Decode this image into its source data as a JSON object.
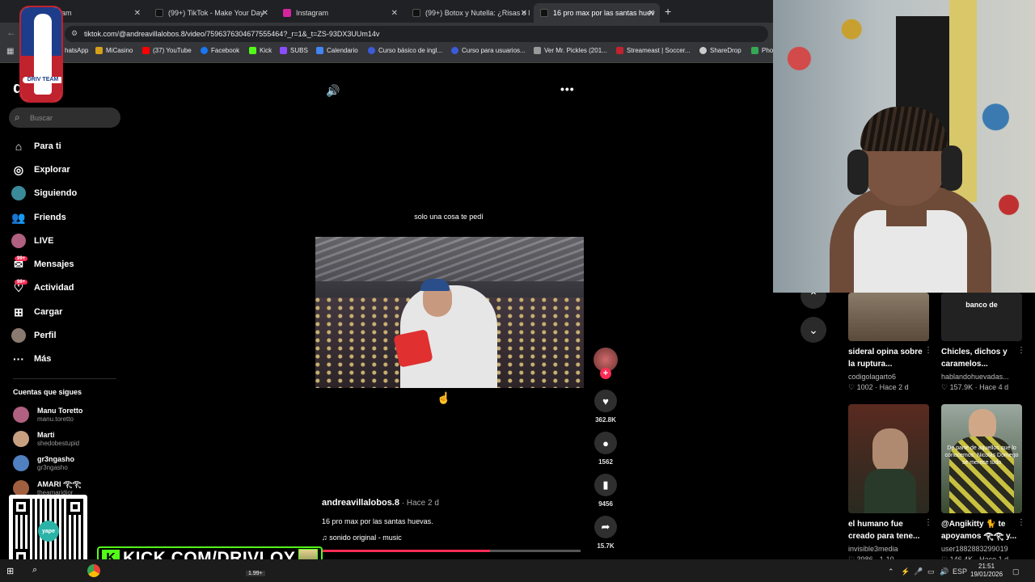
{
  "browser": {
    "tabs": [
      {
        "label": "gram",
        "color": "#888888"
      },
      {
        "label": "(99+) TikTok - Make Your Day",
        "color": "#111111"
      },
      {
        "label": "Instagram",
        "color": "#d6249f"
      },
      {
        "label": "(99+) Botox y Nutella: ¿Risas o l",
        "color": "#111111"
      },
      {
        "label": "16 pro max por las santas huev",
        "color": "#111111"
      }
    ],
    "new_tab": "+",
    "url": "tiktok.com/@andreavillalobos.8/video/7596376304677555464?_r=1&_t=ZS-93DX3UUm14v",
    "bookmarks": [
      {
        "label": "hatsApp",
        "color": "#25d366"
      },
      {
        "label": "MiCasino",
        "color": "#d4a017"
      },
      {
        "label": "(37) YouTube",
        "color": "#ff0000"
      },
      {
        "label": "Facebook",
        "color": "#1877f2"
      },
      {
        "label": "Kick",
        "color": "#53fc18"
      },
      {
        "label": "SUBS",
        "color": "#8a4cff"
      },
      {
        "label": "Calendario",
        "color": "#4285f4"
      },
      {
        "label": "Curso básico de ingl...",
        "color": "#3b5bdb"
      },
      {
        "label": "Curso para usuarios...",
        "color": "#3b5bdb"
      },
      {
        "label": "Ver Mr. Pickles (201...",
        "color": "#999999"
      },
      {
        "label": "Streameast | Soccer...",
        "color": "#c0222e"
      },
      {
        "label": "ShareDrop",
        "color": "#cccccc"
      },
      {
        "label": "Pho",
        "color": "#34a853"
      }
    ]
  },
  "tiktok": {
    "logo": "d     ok",
    "search_placeholder": "Buscar",
    "nav": [
      {
        "label": "Para ti",
        "icon": "home-icon"
      },
      {
        "label": "Explorar",
        "icon": "compass-icon"
      },
      {
        "label": "Siguiendo",
        "icon": "following-avatar-icon"
      },
      {
        "label": "Friends",
        "icon": "friends-icon"
      },
      {
        "label": "LIVE",
        "icon": "live-avatar-icon"
      },
      {
        "label": "Mensajes",
        "icon": "messages-icon",
        "badge": "99+"
      },
      {
        "label": "Actividad",
        "icon": "activity-icon",
        "badge": "99+"
      },
      {
        "label": "Cargar",
        "icon": "upload-icon"
      },
      {
        "label": "Perfil",
        "icon": "profile-icon"
      },
      {
        "label": "Más",
        "icon": "more-icon"
      }
    ],
    "following_title": "Cuentas que sigues",
    "following": [
      {
        "name": "Manu Toretto",
        "handle": "manu.toretto",
        "color": "#b06080"
      },
      {
        "name": "Marti",
        "handle": "shedobestupid",
        "color": "#c8a080"
      },
      {
        "name": "gr3ngasho",
        "handle": "gr3ngasho",
        "color": "#5080c0"
      },
      {
        "name": "AMARI 𓂀𓂀",
        "handle": "theamaridior",
        "color": "#a06040"
      }
    ]
  },
  "video": {
    "caption_overlay": "solo una cosa te pedí",
    "author": "andreavillalobos.8",
    "posted": " · Hace 2 d",
    "description": "16 pro max por las santas huevas.",
    "music_icon": "♫",
    "music": "sonido original - music",
    "progress": 0.65,
    "likes": "362.8K",
    "comments": "1562",
    "saves": "9456",
    "shares": "15.7K"
  },
  "related": [
    {
      "title": "sideral opina sobre la ruptura...",
      "user": "codigolagarto6",
      "meta": "♡ 1002 · Hace 2 d",
      "thumb": "#7a6a58"
    },
    {
      "title": "Chicles, dichos y caramelos...",
      "user": "hablandohuevadas...",
      "meta": "♡ 157.9K · Hace 4 d",
      "thumb": "#222222",
      "overlay": "banco de"
    },
    {
      "title": "el humano fue creado para tene...",
      "user": "invisible3media",
      "meta": "♡ 3986 · 1-10",
      "thumb": "#4a3a2a"
    },
    {
      "title": "@Angikitty 🐈 te apoyamos 𓂀𓂀 y...",
      "user": "user1882883299019",
      "meta": "♡ 146.4K · Hace 1 d",
      "thumb": "#3a4a3a",
      "overlay": "De parte de aquellos que lo conocemos: Nicolás Domego se merece todo"
    }
  ],
  "overlay": {
    "logo_text": "DRIV TEAM",
    "kick_letter": "K",
    "kick_url": "KICK.COM/DRIVLOY",
    "qr_label": "yape"
  },
  "taskbar": {
    "lang": "ESP",
    "time": "21:51",
    "date": "19/01/2026",
    "badge": "1.99+"
  }
}
